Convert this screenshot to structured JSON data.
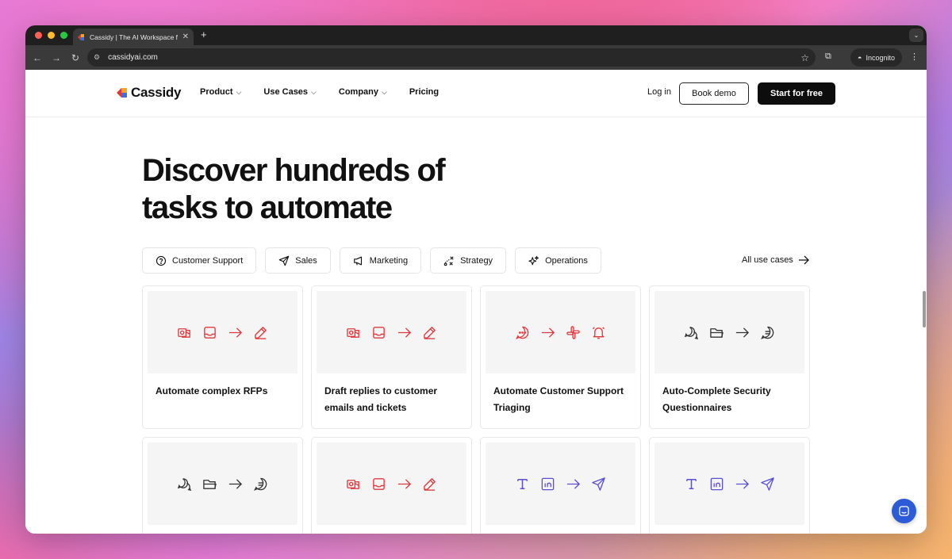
{
  "browser": {
    "tab_title": "Cassidy | The AI Workspace f",
    "url": "cassidyai.com",
    "incognito_label": "Incognito"
  },
  "nav": {
    "logo": "Cassidy",
    "menu": [
      {
        "label": "Product"
      },
      {
        "label": "Use Cases"
      },
      {
        "label": "Company"
      },
      {
        "label": "Pricing"
      }
    ],
    "login": "Log in",
    "book_demo": "Book demo",
    "start_free": "Start for free"
  },
  "hero": {
    "line1": "Discover hundreds of",
    "line2": "tasks to automate"
  },
  "filters": [
    {
      "label": "Customer Support",
      "icon": "question-circle-icon"
    },
    {
      "label": "Sales",
      "icon": "paper-plane-icon"
    },
    {
      "label": "Marketing",
      "icon": "megaphone-icon"
    },
    {
      "label": "Strategy",
      "icon": "strategy-icon"
    },
    {
      "label": "Operations",
      "icon": "sparkle-icon"
    }
  ],
  "all_use_cases": "All use cases",
  "cards": [
    {
      "title": "Automate complex RFPs",
      "icons": [
        "outlook-icon",
        "inbox-icon",
        "arrow-icon",
        "pencil-icon"
      ],
      "color": "#e0383e"
    },
    {
      "title": "Draft replies to customer emails and tickets",
      "icons": [
        "outlook-icon",
        "inbox-icon",
        "arrow-icon",
        "pencil-icon"
      ],
      "color": "#e0383e"
    },
    {
      "title": "Automate Customer Support Triaging",
      "icons": [
        "chat-dots-icon",
        "arrow-icon",
        "slack-icon",
        "bell-icon"
      ],
      "color": "#e0383e"
    },
    {
      "title": "Auto-Complete Security Questionnaires",
      "icons": [
        "chat-bubbles-icon",
        "folder-icon",
        "arrow-icon",
        "message-icon"
      ],
      "color": "#333333"
    },
    {
      "title": "",
      "icons": [
        "chat-bubbles-icon",
        "folder-icon",
        "arrow-icon",
        "message-icon"
      ],
      "color": "#333333"
    },
    {
      "title": "",
      "icons": [
        "outlook-icon",
        "inbox-icon",
        "arrow-icon",
        "pencil-icon"
      ],
      "color": "#e0383e"
    },
    {
      "title": "",
      "icons": [
        "text-icon",
        "linkedin-icon",
        "arrow-icon",
        "paper-plane-icon"
      ],
      "color": "#5b4fd6"
    },
    {
      "title": "",
      "icons": [
        "text-icon",
        "linkedin-icon",
        "arrow-icon",
        "paper-plane-icon"
      ],
      "color": "#5b4fd6"
    }
  ],
  "colors": {
    "brand_red": "#e0383e",
    "brand_purple": "#5b4fd6",
    "chat_button": "#2d5ad6"
  }
}
